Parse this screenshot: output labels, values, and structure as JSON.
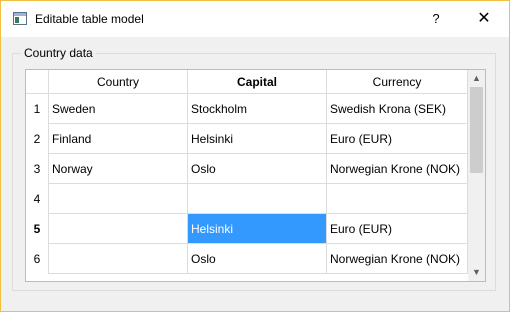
{
  "window": {
    "title": "Editable table model",
    "help_label": "?",
    "close_label": "✕"
  },
  "group": {
    "title": "Country data"
  },
  "table": {
    "columns": [
      {
        "label": "Country",
        "bold": false
      },
      {
        "label": "Capital",
        "bold": true
      },
      {
        "label": "Currency",
        "bold": false
      }
    ],
    "rows": [
      {
        "number": "1",
        "current": false,
        "cells": [
          "Sweden",
          "Stockholm",
          "Swedish Krona (SEK)"
        ]
      },
      {
        "number": "2",
        "current": false,
        "cells": [
          "Finland",
          "Helsinki",
          "Euro (EUR)"
        ]
      },
      {
        "number": "3",
        "current": false,
        "cells": [
          "Norway",
          "Oslo",
          "Norwegian Krone (NOK)"
        ]
      },
      {
        "number": "4",
        "current": false,
        "cells": [
          "",
          "",
          ""
        ]
      },
      {
        "number": "5",
        "current": true,
        "cells": [
          "",
          "Helsinki",
          "Euro (EUR)"
        ]
      },
      {
        "number": "6",
        "current": false,
        "cells": [
          "",
          "Oslo",
          "Norwegian Krone (NOK)"
        ]
      }
    ],
    "selected_cell": {
      "row": 4,
      "col": 1
    }
  },
  "scrollbar": {
    "up_icon": "▲",
    "down_icon": "▼"
  }
}
